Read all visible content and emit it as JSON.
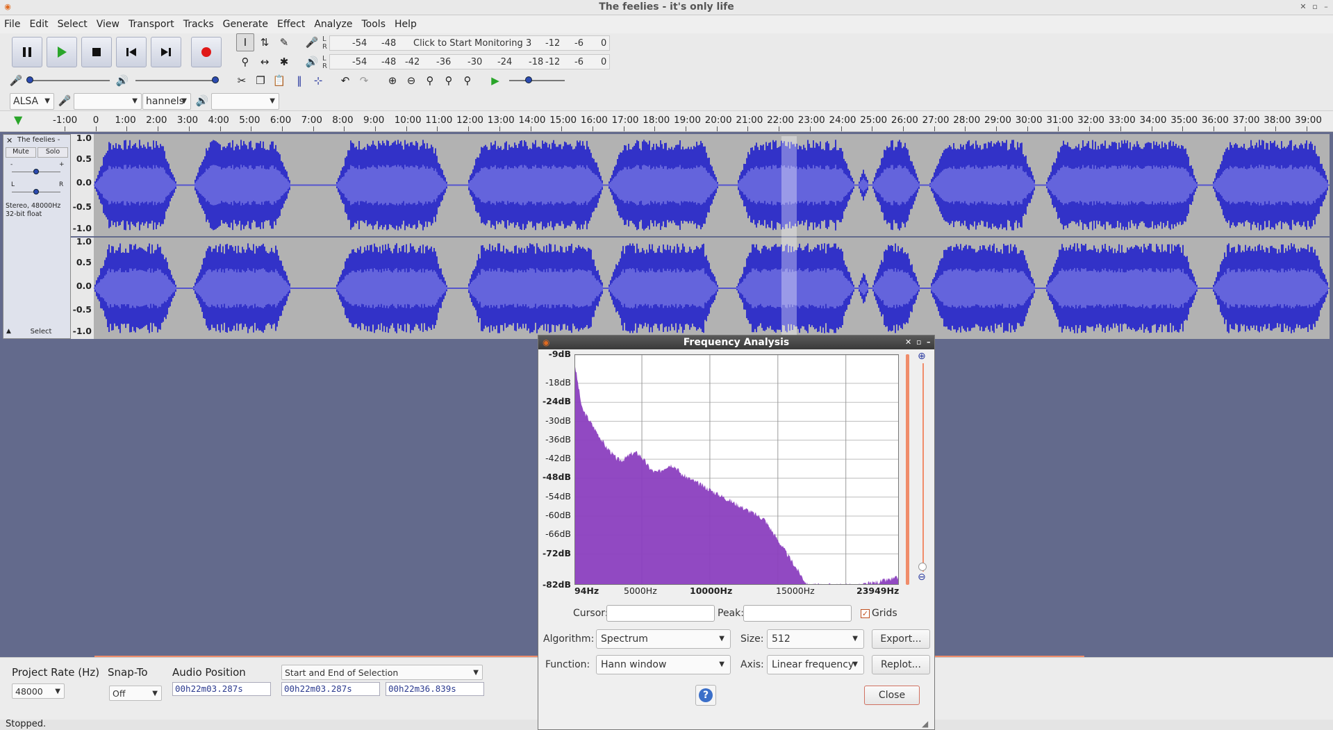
{
  "window": {
    "title": "The feelies - it's only life"
  },
  "menu": [
    "File",
    "Edit",
    "Select",
    "View",
    "Transport",
    "Tracks",
    "Generate",
    "Effect",
    "Analyze",
    "Tools",
    "Help"
  ],
  "transport": {
    "pause": "pause-button",
    "play": "play-button",
    "stop": "stop-button",
    "skip_start": "skip-start-button",
    "skip_end": "skip-end-button",
    "record": "record-button"
  },
  "meters": {
    "record_scale": [
      "-54",
      "-48"
    ],
    "record_monitor": "Click to Start Monitoring",
    "record_scale_right": [
      "3",
      "-12",
      "-6",
      "0"
    ],
    "play_scale": [
      "-54",
      "-48",
      "-42",
      "-36",
      "-30",
      "-24",
      "-18",
      "-12",
      "-6",
      "0"
    ],
    "lr": [
      "L",
      "R"
    ]
  },
  "device": {
    "host": "ALSA",
    "channels": "hannels"
  },
  "ruler": [
    "-1:00",
    "0",
    "1:00",
    "2:00",
    "3:00",
    "4:00",
    "5:00",
    "6:00",
    "7:00",
    "8:00",
    "9:00",
    "10:00",
    "11:00",
    "12:00",
    "13:00",
    "14:00",
    "15:00",
    "16:00",
    "17:00",
    "18:00",
    "19:00",
    "20:00",
    "21:00",
    "22:00",
    "23:00",
    "24:00",
    "25:00",
    "26:00",
    "27:00",
    "28:00",
    "29:00",
    "30:00",
    "31:00",
    "32:00",
    "33:00",
    "34:00",
    "35:00",
    "36:00",
    "37:00",
    "38:00",
    "39:00"
  ],
  "track": {
    "name": "The feelies -",
    "mute": "Mute",
    "solo": "Solo",
    "pan_l": "L",
    "pan_r": "R",
    "gain_minus": "-",
    "gain_plus": "+",
    "info1": "Stereo, 48000Hz",
    "info2": "32-bit float",
    "select": "Select",
    "scale": [
      "1.0",
      "0.5",
      "0.0",
      "-0.5",
      "-1.0"
    ]
  },
  "bottom": {
    "project_rate_label": "Project Rate (Hz)",
    "project_rate_value": "48000",
    "snap_label": "Snap-To",
    "snap_value": "Off",
    "audio_pos_label": "Audio Position",
    "audio_pos_value": "00h22m03.287s",
    "selection_mode": "Start and End of Selection",
    "sel_start": "00h22m03.287s",
    "sel_end": "00h22m36.839s"
  },
  "status": "Stopped.",
  "dialog": {
    "title": "Frequency Analysis",
    "y_labels": [
      "-9dB",
      "-18dB",
      "-24dB",
      "-30dB",
      "-36dB",
      "-42dB",
      "-48dB",
      "-54dB",
      "-60dB",
      "-66dB",
      "-72dB",
      "-82dB"
    ],
    "x_labels": [
      "94Hz",
      "5000Hz",
      "10000Hz",
      "15000Hz",
      "23949Hz"
    ],
    "cursor_label": "Cursor:",
    "peak_label": "Peak:",
    "grids_label": "Grids",
    "grids_checked": true,
    "algorithm_label": "Algorithm:",
    "algorithm_value": "Spectrum",
    "size_label": "Size:",
    "size_value": "512",
    "export_label": "Export...",
    "function_label": "Function:",
    "function_value": "Hann window",
    "axis_label": "Axis:",
    "axis_value": "Linear frequency",
    "replot_label": "Replot...",
    "help_label": "?",
    "close_label": "Close",
    "spectrum_color": "#8b3fbf"
  }
}
